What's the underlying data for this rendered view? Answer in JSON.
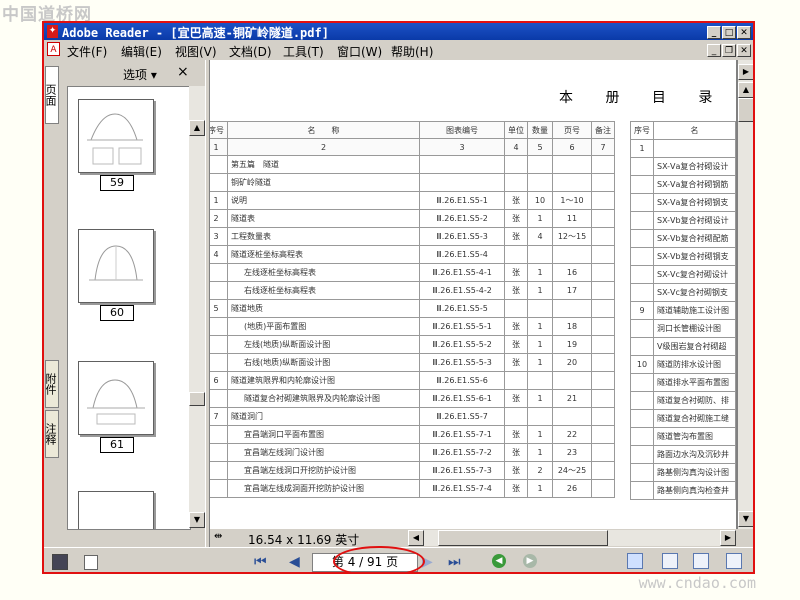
{
  "watermark_top": "中国道桥网",
  "watermark_bottom": "www.cndao.com",
  "window": {
    "title": "Adobe Reader - [宜巴高速-铜矿岭隧道.pdf]",
    "app_icon": "adobe-reader-icon"
  },
  "menu": [
    "文件(F)",
    "编辑(E)",
    "视图(V)",
    "文档(D)",
    "工具(T)",
    "窗口(W)",
    "帮助(H)"
  ],
  "sidebar": {
    "tabs": [
      "页面",
      "附件",
      "注释"
    ],
    "options_label": "选项 ▾",
    "close_label": "×",
    "thumbnails": [
      "59",
      "60",
      "61"
    ]
  },
  "document": {
    "page_title": "本 册 目 录",
    "table_headers": [
      "序号",
      "名　　称",
      "图表编号",
      "单位",
      "数量",
      "页号",
      "备注"
    ],
    "table_index_row": [
      "1",
      "2",
      "3",
      "4",
      "5",
      "6",
      "7"
    ],
    "rows": [
      {
        "no": "",
        "name": "第五篇　隧道",
        "code": "",
        "unit": "",
        "qty": "",
        "page": ""
      },
      {
        "no": "",
        "name": "铜矿岭隧道",
        "code": "",
        "unit": "",
        "qty": "",
        "page": ""
      },
      {
        "no": "1",
        "name": "说明",
        "code": "Ⅲ.26.E1.S5-1",
        "unit": "张",
        "qty": "10",
        "page": "1～10"
      },
      {
        "no": "2",
        "name": "隧道表",
        "code": "Ⅲ.26.E1.S5-2",
        "unit": "张",
        "qty": "1",
        "page": "11"
      },
      {
        "no": "3",
        "name": "工程数量表",
        "code": "Ⅲ.26.E1.S5-3",
        "unit": "张",
        "qty": "4",
        "page": "12～15"
      },
      {
        "no": "4",
        "name": "隧道逐桩坐标高程表",
        "code": "Ⅲ.26.E1.S5-4",
        "unit": "",
        "qty": "",
        "page": ""
      },
      {
        "no": "",
        "name": "左线逐桩坐标高程表",
        "code": "Ⅲ.26.E1.S5-4-1",
        "unit": "张",
        "qty": "1",
        "page": "16"
      },
      {
        "no": "",
        "name": "右线逐桩坐标高程表",
        "code": "Ⅲ.26.E1.S5-4-2",
        "unit": "张",
        "qty": "1",
        "page": "17"
      },
      {
        "no": "5",
        "name": "隧道地质",
        "code": "Ⅲ.26.E1.S5-5",
        "unit": "",
        "qty": "",
        "page": ""
      },
      {
        "no": "",
        "name": "(地质)平面布置图",
        "code": "Ⅲ.26.E1.S5-5-1",
        "unit": "张",
        "qty": "1",
        "page": "18"
      },
      {
        "no": "",
        "name": "左线(地质)纵断面设计图",
        "code": "Ⅲ.26.E1.S5-5-2",
        "unit": "张",
        "qty": "1",
        "page": "19"
      },
      {
        "no": "",
        "name": "右线(地质)纵断面设计图",
        "code": "Ⅲ.26.E1.S5-5-3",
        "unit": "张",
        "qty": "1",
        "page": "20"
      },
      {
        "no": "6",
        "name": "隧道建筑限界和内轮廓设计图",
        "code": "Ⅲ.26.E1.S5-6",
        "unit": "",
        "qty": "",
        "page": ""
      },
      {
        "no": "",
        "name": "隧道复合衬砌建筑限界及内轮廓设计图",
        "code": "Ⅲ.26.E1.S5-6-1",
        "unit": "张",
        "qty": "1",
        "page": "21"
      },
      {
        "no": "7",
        "name": "隧道洞门",
        "code": "Ⅲ.26.E1.S5-7",
        "unit": "",
        "qty": "",
        "page": ""
      },
      {
        "no": "",
        "name": "宜昌端洞口平面布置图",
        "code": "Ⅲ.26.E1.S5-7-1",
        "unit": "张",
        "qty": "1",
        "page": "22"
      },
      {
        "no": "",
        "name": "宜昌端左线洞门设计图",
        "code": "Ⅲ.26.E1.S5-7-2",
        "unit": "张",
        "qty": "1",
        "page": "23"
      },
      {
        "no": "",
        "name": "宜昌端左线洞口开挖防护设计图",
        "code": "Ⅲ.26.E1.S5-7-3",
        "unit": "张",
        "qty": "2",
        "page": "24～25"
      },
      {
        "no": "",
        "name": "宜昌端左线成洞面开挖防护设计图",
        "code": "Ⅲ.26.E1.S5-7-4",
        "unit": "张",
        "qty": "1",
        "page": "26"
      }
    ],
    "right_table_header": [
      "序号",
      "名"
    ],
    "right_rows": [
      {
        "no": "1",
        "name": ""
      },
      {
        "no": "",
        "name": "SX-Ⅴa复合衬砌设计"
      },
      {
        "no": "",
        "name": "SX-Ⅴa复合衬砌钢筋"
      },
      {
        "no": "",
        "name": "SX-Ⅴa复合衬砌钢支"
      },
      {
        "no": "",
        "name": "SX-Ⅴb复合衬砌设计"
      },
      {
        "no": "",
        "name": "SX-Ⅴb复合衬砌配筋"
      },
      {
        "no": "",
        "name": "SX-Ⅴb复合衬砌钢支"
      },
      {
        "no": "",
        "name": "SX-Ⅴc复合衬砌设计"
      },
      {
        "no": "",
        "name": "SX-Ⅴc复合衬砌钢支"
      },
      {
        "no": "9",
        "name": "隧道辅助施工设计图"
      },
      {
        "no": "",
        "name": "洞口长管棚设计图"
      },
      {
        "no": "",
        "name": "Ⅴ级围岩复合衬砌超"
      },
      {
        "no": "10",
        "name": "隧道防排水设计图"
      },
      {
        "no": "",
        "name": "隧道排水平面布置图"
      },
      {
        "no": "",
        "name": "隧道复合衬砌防、排"
      },
      {
        "no": "",
        "name": "隧道复合衬砌施工缝"
      },
      {
        "no": "",
        "name": "隧道管沟布置图"
      },
      {
        "no": "",
        "name": "路面边水沟及沉砂井"
      },
      {
        "no": "",
        "name": "路基侧沟真沟设计图"
      },
      {
        "no": "",
        "name": "路基侧向真沟检查井"
      }
    ]
  },
  "status": {
    "page_size": "16.54 x 11.69 英寸",
    "page_indicator": "第 4 / 91 页"
  }
}
